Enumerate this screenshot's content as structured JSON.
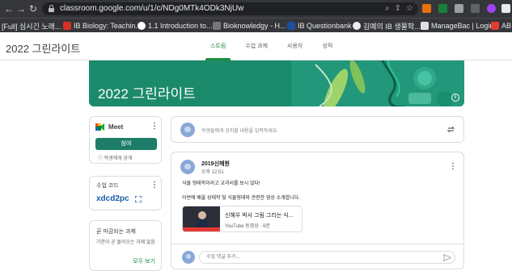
{
  "browser": {
    "url": "classroom.google.com/u/1/c/NDg0MTk4ODk3NjUw",
    "bookmarks": [
      {
        "label": "[Full] 심시긴 노래...",
        "color": "#f0f0f0"
      },
      {
        "label": "IB Biology: Teachin...",
        "color": "#d93025"
      },
      {
        "label": "1.1 Introduction to...",
        "color": "#ffffff"
      },
      {
        "label": "Bioknowledgy - H...",
        "color": "#333333"
      },
      {
        "label": "IB Questionbank",
        "color": "#1e4f9c"
      },
      {
        "label": "김예의 IB 생물학...",
        "color": "#444444"
      },
      {
        "label": "ManageBac | Login",
        "color": "#e0e0e0"
      },
      {
        "label": "AB",
        "color": "#e53935"
      }
    ]
  },
  "header": {
    "title": "2022 그린라이트",
    "tabs": [
      {
        "label": "스트림",
        "active": true
      },
      {
        "label": "수업 과제",
        "active": false
      },
      {
        "label": "사용자",
        "active": false
      },
      {
        "label": "성적",
        "active": false
      }
    ]
  },
  "banner": {
    "title": "2022 그린라이트",
    "info_icon_char": "i"
  },
  "meet": {
    "label": "Meet",
    "join_label": "참여",
    "note": "ⓘ 학생에게 공개"
  },
  "class_code": {
    "label": "수업 코드",
    "value": "xdcd2pc"
  },
  "upcoming": {
    "label": "곧 마감되는 과제",
    "text": "기한이 곧 돌아오는 과제 없음",
    "view_all": "모두 보기"
  },
  "share": {
    "placeholder": "학생들에게 공지할 내용을 입력하세요."
  },
  "post": {
    "author": "2019신혜원",
    "time": "오후 12:51",
    "lines": [
      "식물 형태학이라고 교과서를 보시 않다!",
      "이번에 배울 성태학 및 식물형태와 관련한 영상 소개합니다."
    ],
    "attachment": {
      "title": "신혜우 박사 그림 그리는 식...",
      "subtitle": "YouTube 동영상 · 6분"
    },
    "comment_placeholder": "수업 댓글 추가..."
  },
  "colors": {
    "accent": "#1e8e3e",
    "banner": "#1b8a6b",
    "join_button": "#1e7d68",
    "code": "#1a5ea8"
  }
}
